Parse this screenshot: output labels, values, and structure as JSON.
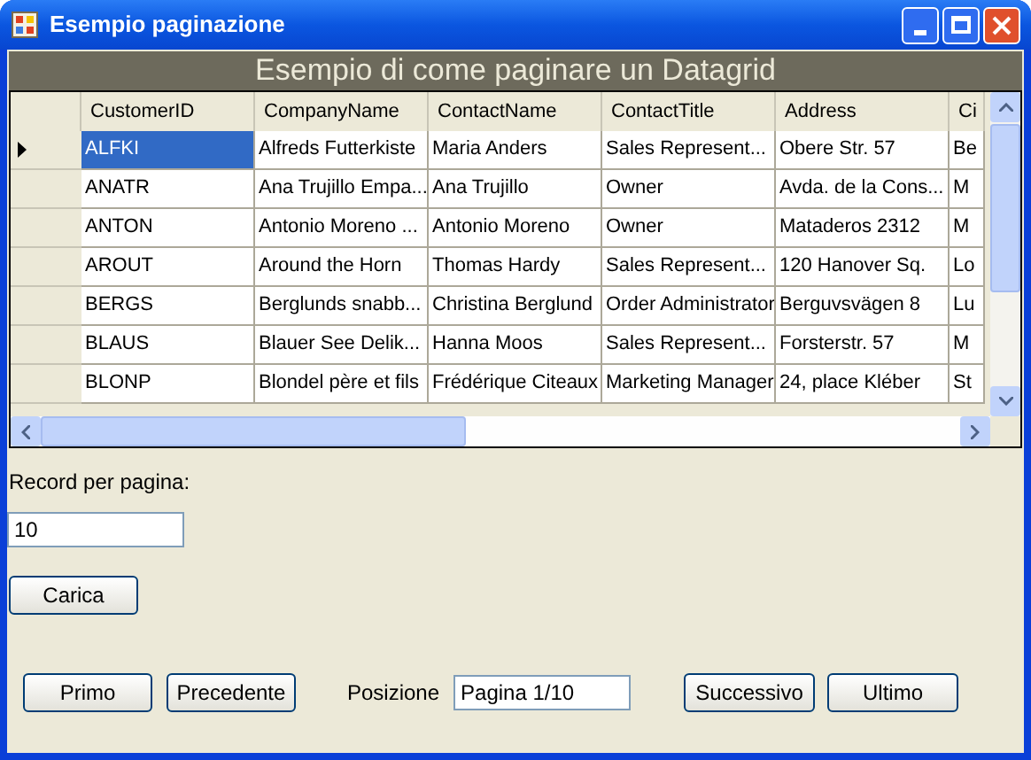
{
  "window": {
    "title": "Esempio paginazione"
  },
  "banner": "Esempio di come paginare un Datagrid",
  "table": {
    "columns": [
      "CustomerID",
      "CompanyName",
      "ContactName",
      "ContactTitle",
      "Address",
      "Ci"
    ],
    "rows": [
      {
        "selected": true,
        "cells": [
          "ALFKI",
          "Alfreds Futterkiste",
          "Maria Anders",
          "Sales Represent...",
          "Obere Str. 57",
          "Be"
        ]
      },
      {
        "selected": false,
        "cells": [
          "ANATR",
          "Ana Trujillo Empa...",
          "Ana Trujillo",
          "Owner",
          "Avda. de la Cons...",
          "M"
        ]
      },
      {
        "selected": false,
        "cells": [
          "ANTON",
          "Antonio Moreno ...",
          "Antonio Moreno",
          "Owner",
          "Mataderos  2312",
          "M"
        ]
      },
      {
        "selected": false,
        "cells": [
          "AROUT",
          "Around the Horn",
          "Thomas Hardy",
          "Sales Represent...",
          "120 Hanover Sq.",
          "Lo"
        ]
      },
      {
        "selected": false,
        "cells": [
          "BERGS",
          "Berglunds snabb...",
          "Christina Berglund",
          "Order Administrator",
          "Berguvsvägen  8",
          "Lu"
        ]
      },
      {
        "selected": false,
        "cells": [
          "BLAUS",
          "Blauer See Delik...",
          "Hanna Moos",
          "Sales Represent...",
          "Forsterstr. 57",
          "M"
        ]
      },
      {
        "selected": false,
        "cells": [
          "BLONP",
          "Blondel père et fils",
          "Frédérique Citeaux",
          "Marketing Manager",
          "24, place Kléber",
          "St"
        ]
      }
    ]
  },
  "records_label": "Record per pagina:",
  "records_field": {
    "value": "10"
  },
  "load_button": "Carica",
  "nav": {
    "first": "Primo",
    "previous": "Precedente",
    "position_label": "Posizione",
    "position_field": {
      "value": "Pagina 1/10"
    },
    "next": "Successivo",
    "last": "Ultimo"
  }
}
